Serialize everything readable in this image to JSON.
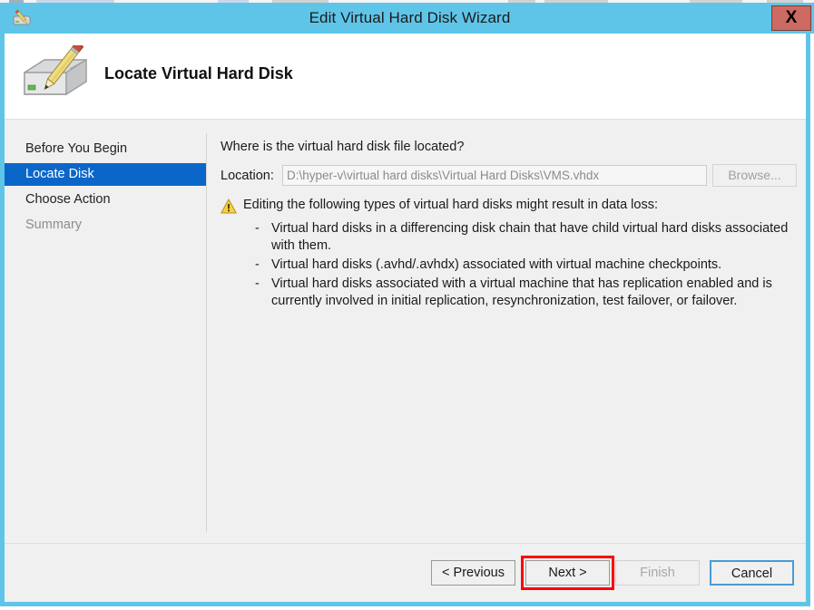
{
  "window": {
    "title": "Edit Virtual Hard Disk Wizard",
    "close_label": "X",
    "titlebar_color": "#5fc5e8",
    "close_button_color": "#cd6a62"
  },
  "header": {
    "title": "Locate Virtual Hard Disk",
    "icon": "hard-disk-with-pencil-icon"
  },
  "sidebar": {
    "items": [
      {
        "label": "Before You Begin",
        "state": "normal"
      },
      {
        "label": "Locate Disk",
        "state": "selected"
      },
      {
        "label": "Choose Action",
        "state": "normal"
      },
      {
        "label": "Summary",
        "state": "disabled"
      }
    ],
    "selected_color": "#0b66c9"
  },
  "content": {
    "question": "Where is the virtual hard disk file located?",
    "location_label": "Location:",
    "location_value": "D:\\hyper-v\\virtual hard disks\\Virtual Hard Disks\\VMS.vhdx",
    "location_placeholder": "",
    "browse_label": "Browse...",
    "warning_icon": "warning-triangle-icon",
    "warning_heading": "Editing the following types of virtual hard disks might result in data loss:",
    "warning_items": [
      "Virtual hard disks in a differencing disk chain that have child virtual hard disks associated with them.",
      "Virtual hard disks (.avhd/.avhdx) associated with virtual machine checkpoints.",
      "Virtual hard disks associated with a virtual machine that has replication enabled and is currently involved in initial replication, resynchronization, test failover, or failover."
    ],
    "bullet_dash": "-"
  },
  "footer": {
    "previous_label": "< Previous",
    "next_label": "Next >",
    "finish_label": "Finish",
    "cancel_label": "Cancel",
    "highlight_color": "#ff0000",
    "focus_color": "#4a9bd4"
  }
}
